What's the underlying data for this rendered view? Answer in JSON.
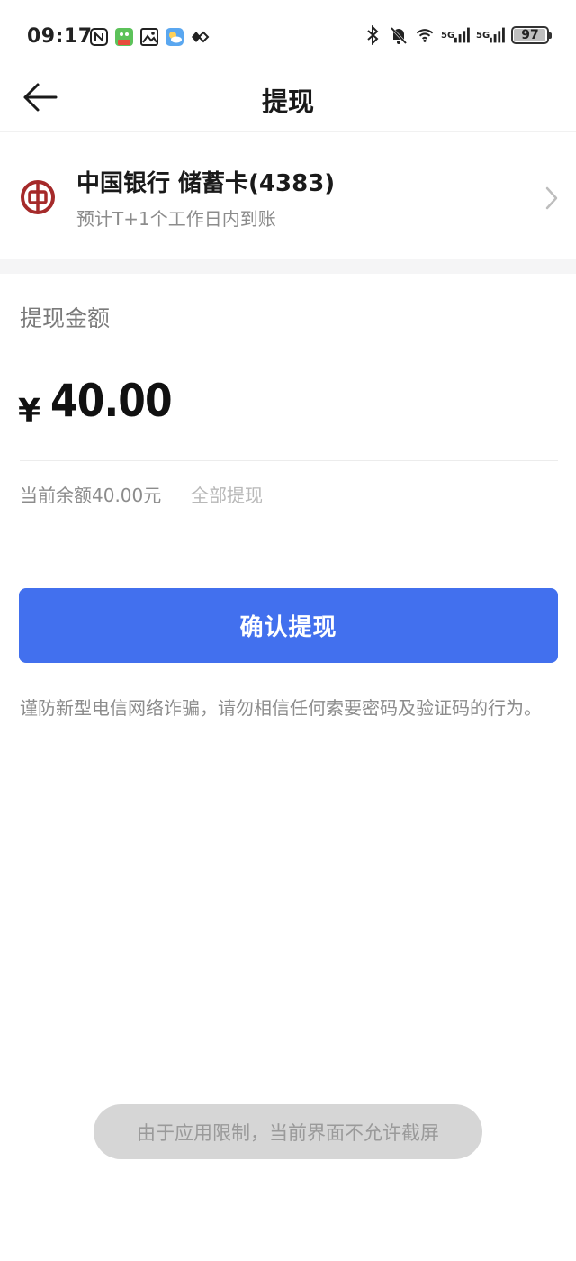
{
  "status_bar": {
    "time": "09:17",
    "battery": "97",
    "battery_level": 0.97,
    "signal_label_1": "5G",
    "signal_label_2": "5G",
    "left_icons": [
      "nfc-icon",
      "app-notification-icon",
      "gallery-icon",
      "weather-icon",
      "diamond-icon"
    ],
    "right_icons": [
      "bluetooth-icon",
      "mute-icon",
      "wifi-icon",
      "signal-icon",
      "signal-icon",
      "battery-icon"
    ]
  },
  "nav": {
    "title": "提现",
    "back_icon": "arrow-left-icon"
  },
  "bank": {
    "name": "中国银行 储蓄卡(4383)",
    "arrival": "预计T+1个工作日内到账",
    "logo_icon": "bank-of-china-logo",
    "chevron_icon": "chevron-right-icon",
    "brand_color": "#a52a2a"
  },
  "amount": {
    "label": "提现金额",
    "currency": "¥",
    "value": "40.00",
    "balance_text": "当前余额40.00元",
    "withdraw_all": "全部提现"
  },
  "confirm": {
    "label": "确认提现",
    "color": "#4270ee"
  },
  "warning": "谨防新型电信网络诈骗，请勿相信任何索要密码及验证码的行为。",
  "toast": "由于应用限制，当前界面不允许截屏"
}
